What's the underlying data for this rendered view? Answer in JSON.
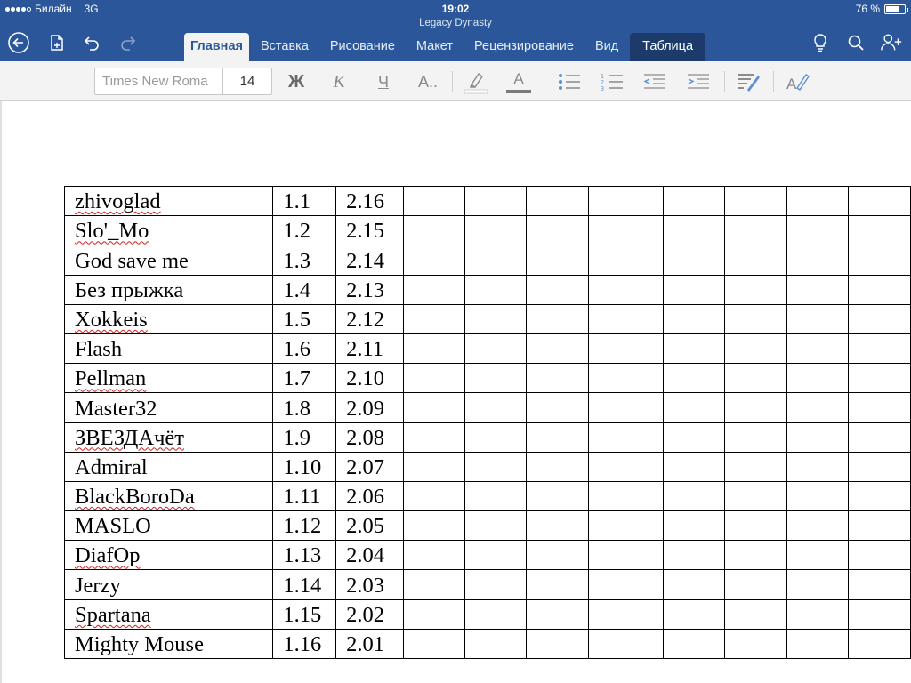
{
  "status_bar": {
    "carrier": "Билайн",
    "network": "3G",
    "time": "19:02",
    "battery": "76 %",
    "battery_level": 0.76
  },
  "document_title": "Legacy Dynasty",
  "toolbar_icons": [
    "back-icon",
    "file-icon",
    "undo-icon",
    "redo-icon"
  ],
  "tabs": [
    {
      "label": "Главная",
      "active": true
    },
    {
      "label": "Вставка"
    },
    {
      "label": "Рисование"
    },
    {
      "label": "Макет"
    },
    {
      "label": "Рецензирование"
    },
    {
      "label": "Вид"
    },
    {
      "label": "Таблица",
      "contextual": true
    }
  ],
  "right_icons": [
    "lightbulb-icon",
    "search-icon",
    "add-person-icon"
  ],
  "ribbon": {
    "font_name": "Times New Roma",
    "font_size": "14",
    "bold_label": "Ж",
    "italic_label": "К",
    "underline_label": "Ч",
    "text_effects_label": "A..",
    "font_color_label": "A",
    "highlight_color": "#ffffff",
    "font_color": "#7a7a7a"
  },
  "colors": {
    "accent": "#2b579a",
    "table_tab": "#1c3b6a",
    "spellcheck": "#d02020"
  },
  "table": {
    "rows": [
      {
        "name": "zhivoglad",
        "a": "1.1",
        "b": "2.16",
        "spell": true
      },
      {
        "name": "Slo'_Mo",
        "a": "1.2",
        "b": "2.15",
        "spell": true
      },
      {
        "name": "God save me",
        "a": "1.3",
        "b": "2.14",
        "spell": false
      },
      {
        "name": "Без прыжка",
        "a": "1.4",
        "b": "2.13",
        "spell": false
      },
      {
        "name": "Xokkeis",
        "a": "1.5",
        "b": "2.12",
        "spell": true
      },
      {
        "name": "Flash",
        "a": "1.6",
        "b": "2.11",
        "spell": false
      },
      {
        "name": "Pellman",
        "a": "1.7",
        "b": "2.10",
        "spell": true
      },
      {
        "name": "Master32",
        "a": "1.8",
        "b": "2.09",
        "spell": false
      },
      {
        "name": "ЗВЕЗДАчёт",
        "a": "1.9",
        "b": "2.08",
        "spell": true
      },
      {
        "name": "Admiral",
        "a": "1.10",
        "b": "2.07",
        "spell": false
      },
      {
        "name": "BlackBoroDa",
        "a": "1.11",
        "b": "2.06",
        "spell": true
      },
      {
        "name": "MASLO",
        "a": "1.12",
        "b": "2.05",
        "spell": false
      },
      {
        "name": "DiafOp",
        "a": "1.13",
        "b": "2.04",
        "spell": true
      },
      {
        "name": "Jerzy",
        "a": "1.14",
        "b": "2.03",
        "spell": false
      },
      {
        "name": "Spartana",
        "a": "1.15",
        "b": "2.02",
        "spell": true
      },
      {
        "name": "Mighty Mouse",
        "a": "1.16",
        "b": "2.01",
        "spell": false
      }
    ],
    "empty_columns": 8
  }
}
